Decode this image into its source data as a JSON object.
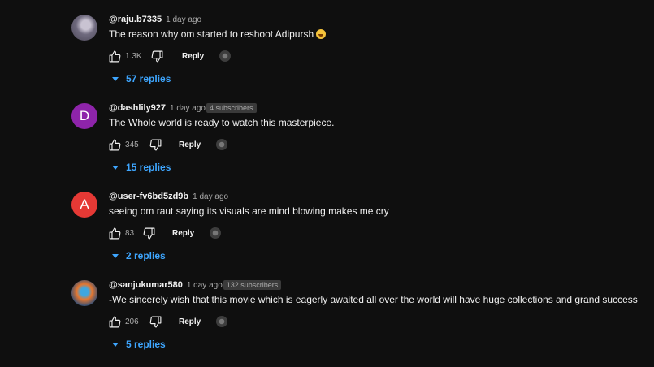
{
  "comments": [
    {
      "author": "@raju.b7335",
      "date": "1 day ago",
      "text": "The reason why om started to reshoot Adipursh",
      "likes": "1.3K",
      "reply_label": "Reply",
      "replies_label": "57 replies",
      "avatar": {
        "type": "photo"
      },
      "emoji": "grinning-face-with-sweat"
    },
    {
      "author": "@dashlily927",
      "date": "1 day ago",
      "subscribers": "4 subscribers",
      "text": "The Whole world is ready to watch this masterpiece.",
      "likes": "345",
      "reply_label": "Reply",
      "replies_label": "15 replies",
      "avatar": {
        "type": "letter",
        "letter": "D",
        "color": "#8e24aa"
      }
    },
    {
      "author": "@user-fv6bd5zd9b",
      "date": "1 day ago",
      "text": "seeing om raut saying its visuals are mind blowing makes me cry",
      "likes": "83",
      "reply_label": "Reply",
      "replies_label": "2 replies",
      "avatar": {
        "type": "letter",
        "letter": "A",
        "color": "#e53935"
      }
    },
    {
      "author": "@sanjukumar580",
      "date": "1 day ago",
      "subscribers": "132 subscribers",
      "text": "-We sincerely wish that this movie which is eagerly awaited all over the world will have huge collections and grand success",
      "likes": "206",
      "reply_label": "Reply",
      "replies_label": "5 replies",
      "avatar": {
        "type": "photo"
      }
    }
  ],
  "colors": {
    "background": "#0f0f0f",
    "text": "#f1f1f1",
    "secondary_text": "#aaaaaa",
    "replies_link": "#3ea6ff"
  },
  "icons": [
    "thumbs-up-icon",
    "thumbs-down-icon",
    "creator-heart-icon",
    "chevron-down-icon"
  ]
}
